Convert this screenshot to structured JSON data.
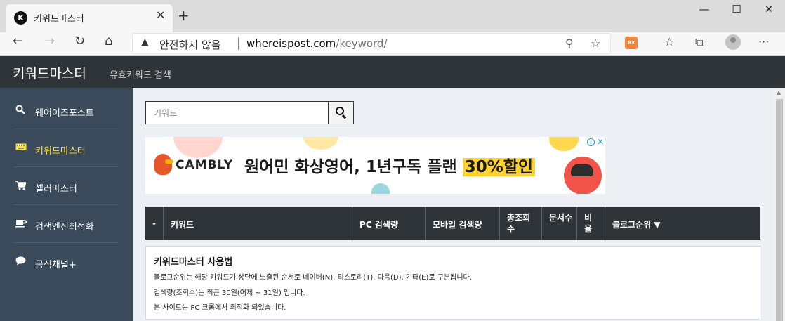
{
  "browser": {
    "tab_favicon_letter": "K",
    "tab_title": "키워드마스터",
    "tab_close": "✕",
    "new_tab": "+",
    "minimize": "—",
    "maximize": "☐",
    "close": "✕",
    "address": {
      "security_icon": "warning-triangle-icon",
      "security_label": "안전하지 않음",
      "host": "whereispost.com",
      "path": "/keyword/"
    },
    "extension_label": "RX"
  },
  "header": {
    "brand": "키워드마스터",
    "subtitle": "유효키워드 검색"
  },
  "sidebar": {
    "items": [
      {
        "icon": "search-icon",
        "glyph": "🔍",
        "label": "웨어이즈포스트",
        "active": false
      },
      {
        "icon": "keyboard-icon",
        "glyph": "⌨",
        "label": "키워드마스터",
        "active": true
      },
      {
        "icon": "cart-icon",
        "glyph": "🛒",
        "label": "셀러마스터",
        "active": false
      },
      {
        "icon": "coffee-icon",
        "glyph": "☕",
        "label": "검색엔진최적화",
        "active": false
      },
      {
        "icon": "chat-icon",
        "glyph": "💬",
        "label": "공식채널+",
        "active": false
      }
    ]
  },
  "search": {
    "placeholder": "키워드"
  },
  "ad": {
    "brand": "CAMBLY",
    "headline_main": "원어민 화상영어, 1년구독 플랜 ",
    "headline_highlight": "30%할인"
  },
  "table": {
    "headers": [
      "-",
      "키워드",
      "PC 검색량",
      "모바일 검색량",
      "총조회수",
      "문서수",
      "비율",
      "블로그순위 ▼"
    ]
  },
  "usage": {
    "title": "키워드마스터 사용법",
    "lines": [
      "블로그순위는 해당 키워드가 상단에 노출된 순서로 네이버(N), 티스토리(T), 다음(D), 기타(E)로 구분됩니다.",
      "검색량(조회수)는 최근 30일(어제 ~ 31일) 입니다.",
      "본 사이트는 PC 크롬에서 최적화 되었습니다."
    ]
  }
}
